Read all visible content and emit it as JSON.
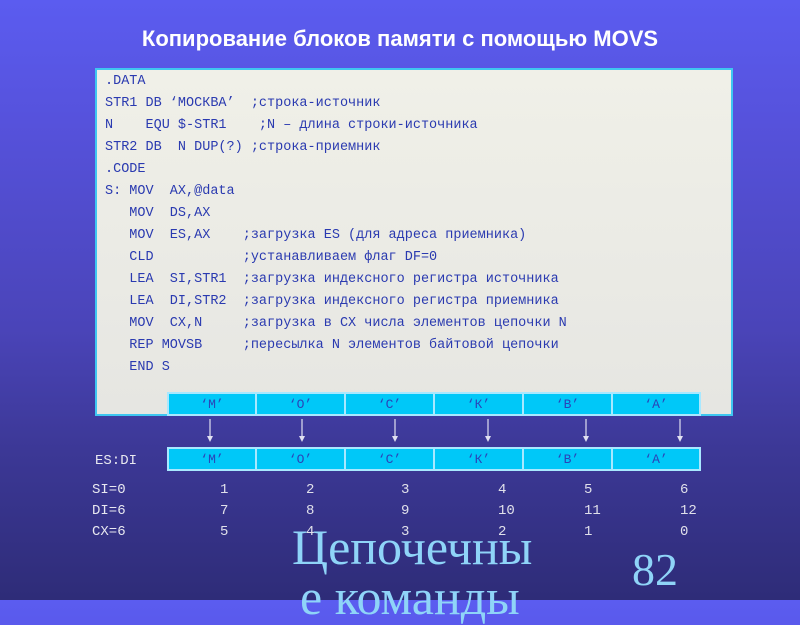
{
  "title": "Копирование блоков памяти с помощью MOVS",
  "code_lines": [
    ".DATA",
    "STR1 DB ‘МОСКВА’  ;строка-источник",
    "N    EQU $-STR1    ;N – длина строки-источника",
    "STR2 DB  N DUP(?) ;строка-приемник",
    ".CODE",
    "S: MOV  AX,@data",
    "   MOV  DS,AX",
    "   MOV  ES,AX    ;загрузка ES (для адреса приемника)",
    "   CLD           ;устанавливаем флаг DF=0",
    "   LEA  SI,STR1  ;загрузка индексного регистра источника",
    "   LEA  DI,STR2  ;загрузка индексного регистра приемника",
    "   MOV  CX,N     ;загрузка в CX числа элементов цепочки N",
    "   REP MOVSB     ;пересылка N элементов байтовой цепочки",
    "   END S"
  ],
  "source_cells": [
    "‘М’",
    "‘О’",
    "‘С’",
    "‘К’",
    "‘В’",
    "‘А’"
  ],
  "dest_label": "ES:DI",
  "dest_cells": [
    "‘М’",
    "‘О’",
    "‘С’",
    "‘К’",
    "‘В’",
    "‘А’"
  ],
  "registers": {
    "labels": [
      "SI=0",
      "DI=6",
      "CX=6"
    ],
    "si_values": [
      "1",
      "2",
      "3",
      "4",
      "5",
      "6"
    ],
    "di_values": [
      "7",
      "8",
      "9",
      "10",
      "11",
      "12"
    ],
    "cx_values": [
      "5",
      "4",
      "3",
      "2",
      "1",
      "0"
    ]
  },
  "footer": {
    "section_title_line1": "Цепочечны",
    "section_title_line2": "е команды",
    "page_number": "82"
  },
  "colors": {
    "cell_fill": "#00c8f8",
    "code_text": "#2a3ab0",
    "footer_text": "#8fd4f8"
  }
}
